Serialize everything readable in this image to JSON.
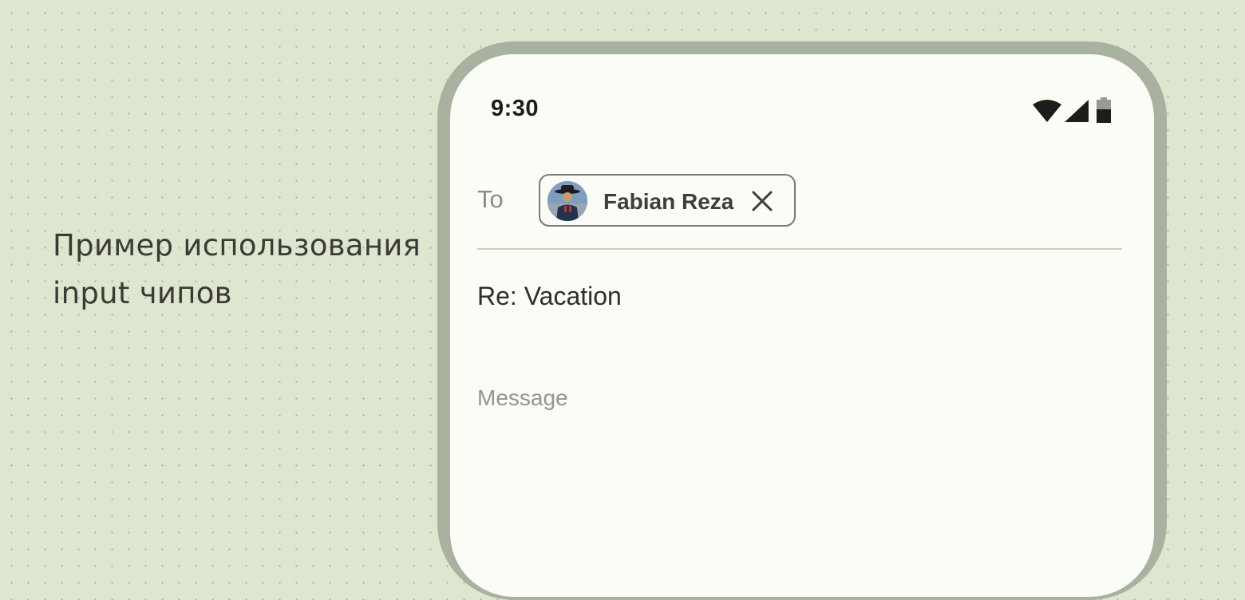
{
  "caption": {
    "line1": "Пример использования",
    "line2": "input чипов"
  },
  "status_bar": {
    "time": "9:30",
    "icons": [
      "wifi-icon",
      "cellular-signal-icon",
      "battery-icon"
    ]
  },
  "compose": {
    "to_label": "To",
    "recipient_chip": {
      "name": "Fabian Reza",
      "avatar": "person-avatar",
      "close_icon": "close-icon"
    },
    "subject": "Re: Vacation",
    "message_placeholder": "Message",
    "message_value": ""
  },
  "colors": {
    "background": "#dde6cf",
    "phone_frame": "#a9b2a0",
    "screen": "#fcfcf6",
    "chip_border": "#7a7a72"
  }
}
